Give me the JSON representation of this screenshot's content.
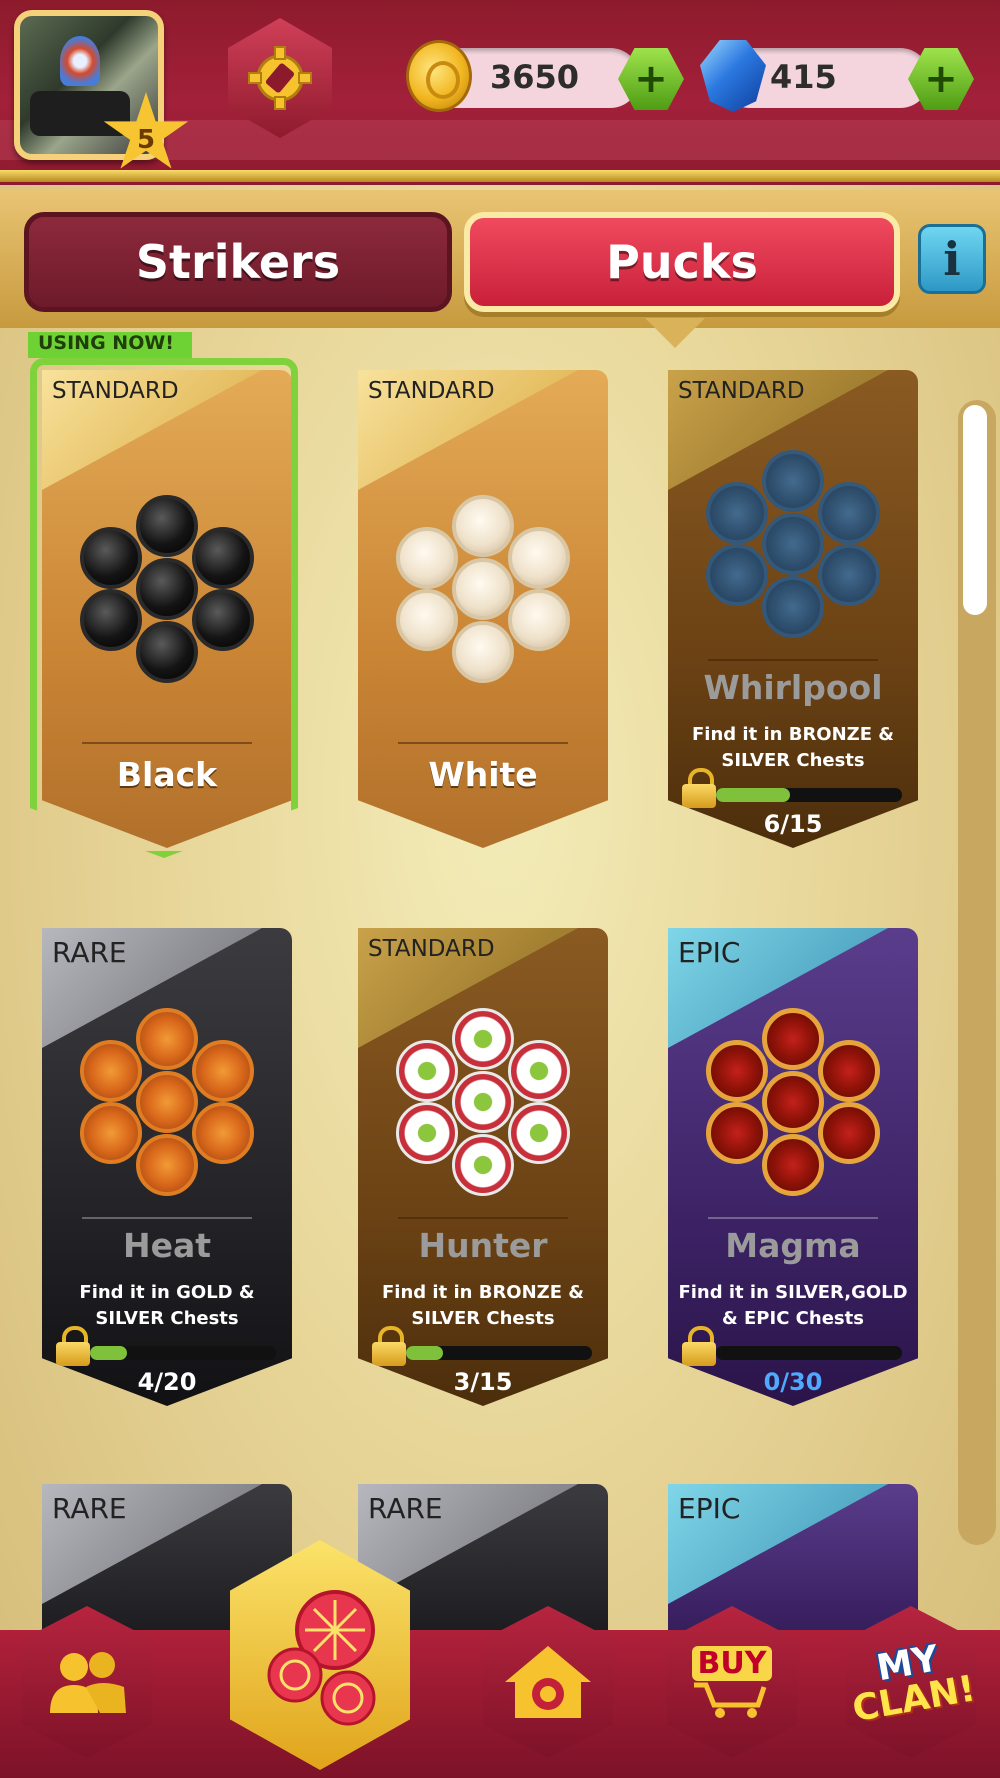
{
  "header": {
    "level": "5",
    "coins": "3650",
    "gems": "415",
    "add_label": "+"
  },
  "tabs": [
    {
      "label": "Strikers",
      "active": false
    },
    {
      "label": "Pucks",
      "active": true
    }
  ],
  "info_label": "i",
  "using_now_label": "USING NOW!",
  "cards": [
    {
      "tier": "STANDARD",
      "name": "Black",
      "owned": true,
      "using": true,
      "puck_style": "black"
    },
    {
      "tier": "STANDARD",
      "name": "White",
      "owned": true,
      "using": false,
      "puck_style": "white"
    },
    {
      "tier": "STANDARD",
      "name": "Whirlpool",
      "owned": false,
      "desc": "Find it in BRONZE & SILVER Chests",
      "progress": "6/15",
      "progress_value": 0.4,
      "puck_style": "whirl"
    },
    {
      "tier": "RARE",
      "name": "Heat",
      "owned": false,
      "desc": "Find it in GOLD & SILVER Chests",
      "progress": "4/20",
      "progress_value": 0.2,
      "puck_style": "heat"
    },
    {
      "tier": "STANDARD",
      "name": "Hunter",
      "owned": false,
      "desc": "Find it in BRONZE & SILVER Chests",
      "progress": "3/15",
      "progress_value": 0.2,
      "puck_style": "hunter"
    },
    {
      "tier": "EPIC",
      "name": "Magma",
      "owned": false,
      "desc": "Find it in SILVER,GOLD & EPIC Chests",
      "progress": "0/30",
      "progress_value": 0.0,
      "puck_style": "magma"
    },
    {
      "tier": "RARE"
    },
    {
      "tier": "RARE"
    },
    {
      "tier": "EPIC"
    }
  ],
  "nav": {
    "shop_label": "BUY",
    "clan_line1": "MY",
    "clan_line2": "CLAN!"
  },
  "colors": {
    "header_red": "#a3203a",
    "tab_active": "#e8364e",
    "using_green": "#7fd23c",
    "progress_green": "#7fc13a",
    "epic_progress_text": "#4ea9ff"
  }
}
